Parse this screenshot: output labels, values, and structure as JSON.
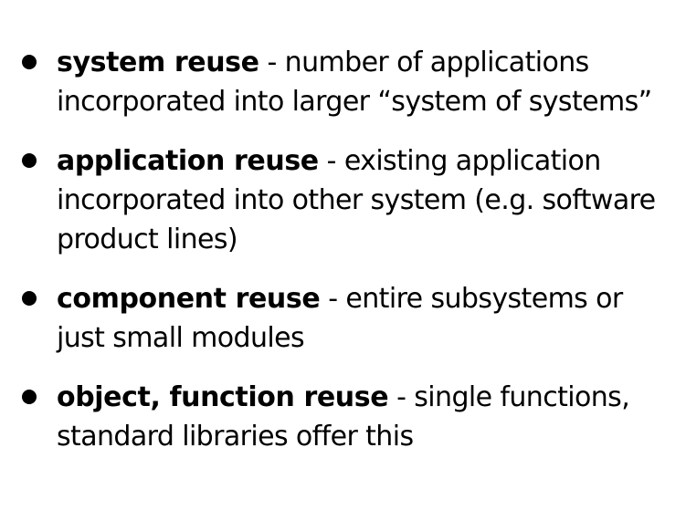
{
  "bullets": [
    {
      "term": "system reuse",
      "separator": " - ",
      "description": "number of applications incorporated into larger “system of systems”"
    },
    {
      "term": "application reuse",
      "separator": " - ",
      "description": "existing application incorporated into other system (e.g. software product lines)"
    },
    {
      "term": "component reuse",
      "separator": " - ",
      "description": "entire subsystems or just small modules"
    },
    {
      "term": "object, function reuse",
      "separator": " - ",
      "description": "single functions, standard libraries offer this"
    }
  ]
}
